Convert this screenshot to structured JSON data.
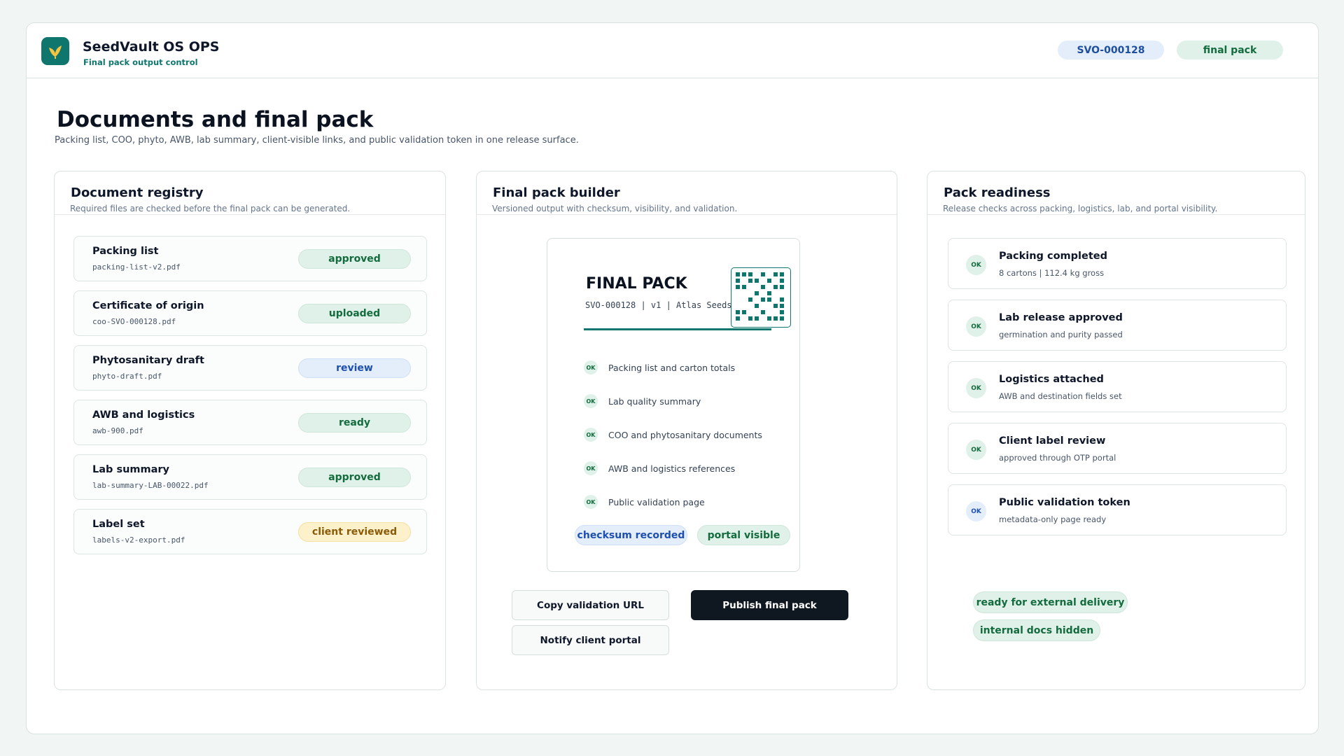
{
  "app": {
    "title": "SeedVault OS OPS",
    "subtitle": "Final pack output control",
    "logo_icon": "leaf-icon",
    "accent": "#0f766e",
    "order_id": "SVO-000128",
    "stage": "final pack"
  },
  "page": {
    "title": "Documents and final pack",
    "subtitle": "Packing list, COO, phyto, AWB, lab summary, client-visible links, and public validation token in one release surface."
  },
  "registry": {
    "title": "Document registry",
    "subtitle": "Required files are checked before the final pack can be generated.",
    "documents": [
      {
        "name": "Packing list",
        "file": "packing-list-v2.pdf",
        "status": "approved",
        "status_color": "green"
      },
      {
        "name": "Certificate of origin",
        "file": "coo-SVO-000128.pdf",
        "status": "uploaded",
        "status_color": "green"
      },
      {
        "name": "Phytosanitary draft",
        "file": "phyto-draft.pdf",
        "status": "review",
        "status_color": "blue"
      },
      {
        "name": "AWB and logistics",
        "file": "awb-900.pdf",
        "status": "ready",
        "status_color": "green"
      },
      {
        "name": "Lab summary",
        "file": "lab-summary-LAB-00022.pdf",
        "status": "approved",
        "status_color": "green"
      },
      {
        "name": "Label set",
        "file": "labels-v2-export.pdf",
        "status": "client reviewed",
        "status_color": "amber"
      }
    ]
  },
  "builder": {
    "title": "Final pack builder",
    "subtitle": "Versioned output with checksum, visibility, and validation.",
    "pack_title": "FINAL PACK",
    "pack_meta": "SVO-000128 | v1 | Atlas Seeds",
    "qr_icon": "qr-code-icon",
    "check_mark": "OK",
    "checks": [
      "Packing list and carton totals",
      "Lab quality summary",
      "COO and phytosanitary documents",
      "AWB and logistics references",
      "Public validation page"
    ],
    "checksum_pill": "checksum recorded",
    "visibility_pill": "portal visible",
    "copy_button": "Copy validation URL",
    "publish_button": "Publish final pack",
    "notify_button": "Notify client portal"
  },
  "readiness": {
    "title": "Pack readiness",
    "subtitle": "Release checks across packing, logistics, lab, and portal visibility.",
    "items": [
      {
        "mark": "OK",
        "title": "Packing completed",
        "detail": "8 cartons | 112.4 kg gross",
        "color": "green"
      },
      {
        "mark": "OK",
        "title": "Lab release approved",
        "detail": "germination and purity passed",
        "color": "green"
      },
      {
        "mark": "OK",
        "title": "Logistics attached",
        "detail": "AWB and destination fields set",
        "color": "green"
      },
      {
        "mark": "OK",
        "title": "Client label review",
        "detail": "approved through OTP portal",
        "color": "green"
      },
      {
        "mark": "OK",
        "title": "Public validation token",
        "detail": "metadata-only page ready",
        "color": "blue"
      }
    ],
    "states": [
      "ready for external delivery",
      "internal docs hidden"
    ]
  }
}
